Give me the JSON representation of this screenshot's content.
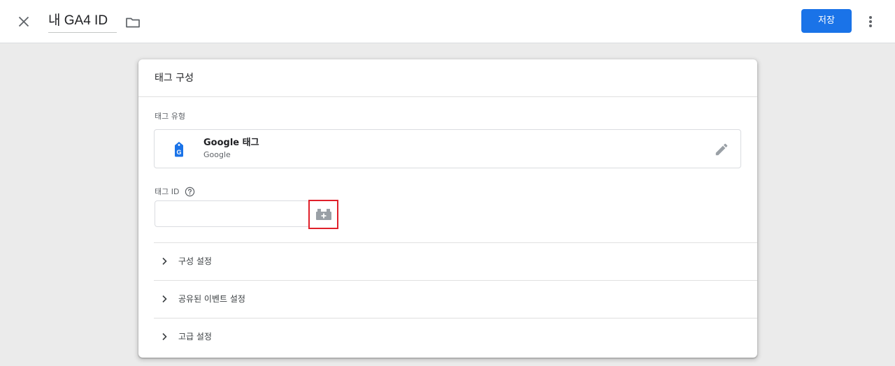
{
  "header": {
    "title": "내 GA4 ID",
    "save_label": "저장",
    "icons": [
      "close-icon",
      "folder-icon",
      "more-vert-icon"
    ]
  },
  "card": {
    "title": "태그 구성",
    "tag_type_label": "태그 유형",
    "tag_type": {
      "name": "Google 태그",
      "vendor": "Google",
      "icon": "google-tag-icon"
    },
    "tag_id_label": "태그 ID",
    "tag_id_value": "",
    "sections": [
      {
        "label": "구성 설정"
      },
      {
        "label": "공유된 이벤트 설정"
      },
      {
        "label": "고급 설정"
      }
    ]
  },
  "colors": {
    "accent": "#1a73e8",
    "highlight": "#e0202a",
    "background": "#ebebeb"
  }
}
